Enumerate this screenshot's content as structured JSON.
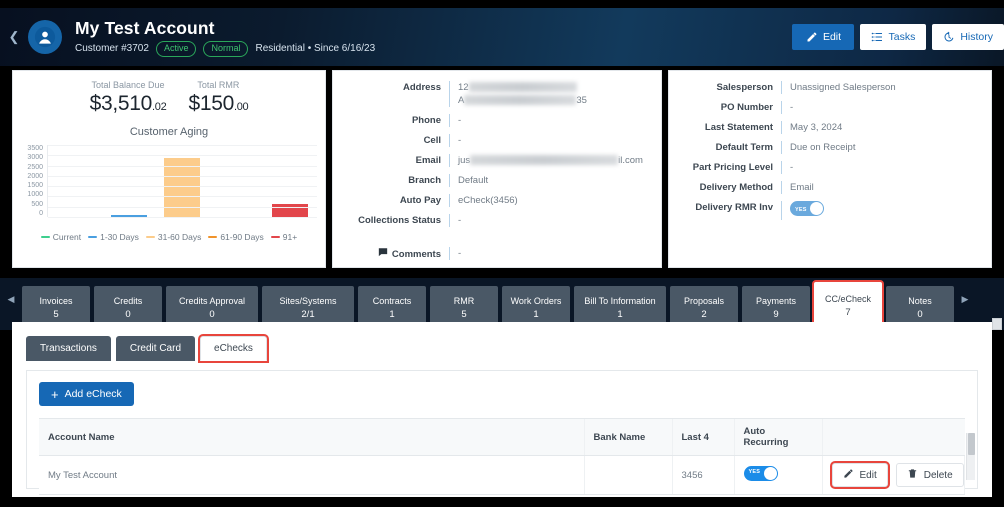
{
  "header": {
    "collapse_icon": "chevron-left-icon",
    "avatar_icon": "user-avatar-icon",
    "title": "My Test Account",
    "customer_number": "Customer #3702",
    "status_pill": "Active",
    "priority_pill": "Normal",
    "meta": "Residential • Since 6/16/23",
    "actions": [
      {
        "label": "Edit",
        "icon": "pencil-icon",
        "style": "primary"
      },
      {
        "label": "Tasks",
        "icon": "task-list-icon",
        "style": "ghost"
      },
      {
        "label": "History",
        "icon": "history-clock-icon",
        "style": "ghost"
      }
    ]
  },
  "summary": {
    "total_balance_label": "Total Balance Due",
    "total_balance_value": "$3,510",
    "total_balance_cents": ".02",
    "total_rmr_label": "Total RMR",
    "total_rmr_value": "$150",
    "total_rmr_cents": ".00"
  },
  "chart_data": {
    "type": "bar",
    "title": "Customer Aging",
    "categories": [
      "Current",
      "1-30 Days",
      "31-60 Days",
      "61-90 Days",
      "91+"
    ],
    "values": [
      0,
      30,
      2850,
      0,
      650
    ],
    "colors": [
      "#3ecf8e",
      "#4a9fe0",
      "#fccc8b",
      "#f0932b",
      "#e2464b"
    ],
    "legend": [
      "Current",
      "1-30 Days",
      "31-60 Days",
      "61-90 Days",
      "91+"
    ],
    "legend_position": "bottom",
    "ylabel": "",
    "xlabel": "",
    "ylim": [
      0,
      3500
    ],
    "yticks": [
      "3500",
      "3000",
      "2500",
      "2000",
      "1500",
      "1000",
      "500",
      "0"
    ],
    "grid": true
  },
  "details_left": [
    {
      "label": "Address",
      "value": "",
      "redacted": true,
      "redact_prefix": "12",
      "redact_suffix": "35",
      "lines": 2
    },
    {
      "label": "Phone",
      "value": "-"
    },
    {
      "label": "Cell",
      "value": "-"
    },
    {
      "label": "Email",
      "value": "",
      "redacted": true,
      "redact_prefix": "jus",
      "redact_suffix": "il.com",
      "lines": 1
    },
    {
      "label": "Branch",
      "value": "Default"
    },
    {
      "label": "Auto Pay",
      "value": "eCheck(3456)"
    },
    {
      "label": "Collections Status",
      "value": "-"
    }
  ],
  "comments": {
    "label": "Comments",
    "icon": "comment-bubble-icon",
    "value": "-"
  },
  "details_right": [
    {
      "label": "Salesperson",
      "value": "Unassigned Salesperson"
    },
    {
      "label": "PO Number",
      "value": "-"
    },
    {
      "label": "Last Statement",
      "value": "May 3, 2024"
    },
    {
      "label": "Default Term",
      "value": "Due on Receipt"
    },
    {
      "label": "Part Pricing Level",
      "value": "-"
    },
    {
      "label": "Delivery Method",
      "value": "Email"
    },
    {
      "label": "Delivery RMR Inv",
      "value": "",
      "toggle": true,
      "toggle_text": "YES"
    }
  ],
  "tabs": {
    "scroll_left_icon": "chevron-left-icon",
    "scroll_right_icon": "chevron-right-icon",
    "items": [
      {
        "label": "Invoices",
        "count": "5",
        "active": false
      },
      {
        "label": "Credits",
        "count": "0",
        "active": false
      },
      {
        "label": "Credits Approval",
        "count": "0",
        "active": false,
        "wide": true
      },
      {
        "label": "Sites/Systems",
        "count": "2/1",
        "active": false,
        "wide": true
      },
      {
        "label": "Contracts",
        "count": "1",
        "active": false
      },
      {
        "label": "RMR",
        "count": "5",
        "active": false
      },
      {
        "label": "Work Orders",
        "count": "1",
        "active": false
      },
      {
        "label": "Bill To Information",
        "count": "1",
        "active": false,
        "wide": true
      },
      {
        "label": "Proposals",
        "count": "2",
        "active": false
      },
      {
        "label": "Payments",
        "count": "9",
        "active": false
      },
      {
        "label": "CC/eCheck",
        "count": "7",
        "active": true
      },
      {
        "label": "Notes",
        "count": "0",
        "active": false
      }
    ]
  },
  "subtabs": [
    {
      "label": "Transactions",
      "active": false
    },
    {
      "label": "Credit Card",
      "active": false
    },
    {
      "label": "eChecks",
      "active": true
    }
  ],
  "add_button": {
    "label": "Add eCheck",
    "icon": "plus-icon"
  },
  "table": {
    "columns": [
      "Account Name",
      "Bank Name",
      "Last 4",
      "Auto Recurring",
      ""
    ],
    "rows": [
      {
        "account_name": "My Test Account",
        "bank_name": "",
        "last4": "3456",
        "auto_recurring": "YES",
        "edit_label": "Edit",
        "edit_icon": "pencil-icon",
        "delete_label": "Delete",
        "delete_icon": "trash-icon"
      }
    ]
  },
  "colors": {
    "brand_blue": "#1668b5",
    "header_navy": "#0a1626",
    "highlight_red": "#e8453c",
    "tab_slate": "#4a5866"
  }
}
